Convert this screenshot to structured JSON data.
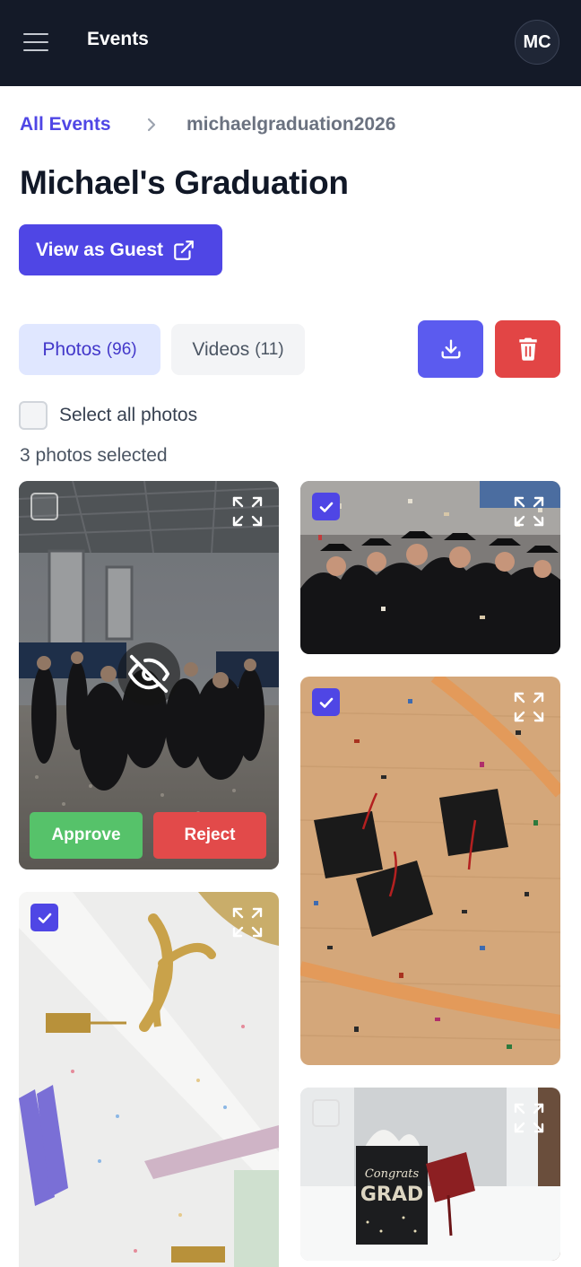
{
  "header": {
    "title": "Events",
    "avatar_initials": "MC"
  },
  "breadcrumb": {
    "parent": "All Events",
    "current": "michaelgraduation2026"
  },
  "page": {
    "title": "Michael's Graduation",
    "view_as_guest": "View as Guest"
  },
  "tabs": [
    {
      "label": "Photos",
      "count": "(96)",
      "active": true
    },
    {
      "label": "Videos",
      "count": "(11)",
      "active": false
    }
  ],
  "actions": {
    "download_icon": "download-icon",
    "delete_icon": "trash-icon"
  },
  "selection": {
    "select_all_label": "Select all photos",
    "selected_count": "3 photos selected"
  },
  "moderation": {
    "approve": "Approve",
    "reject": "Reject"
  },
  "photos": [
    {
      "subject": "graduates dancing in gym",
      "selected": false,
      "hidden": true
    },
    {
      "subject": "graduates celebrating with confetti",
      "selected": true,
      "hidden": false
    },
    {
      "subject": "graduation caps on confetti floor",
      "selected": true,
      "hidden": false
    },
    {
      "subject": "diploma with gold ribbon and tassels",
      "selected": true,
      "hidden": false
    },
    {
      "subject": "congrats grad gift bag",
      "selected": false,
      "hidden": false
    }
  ],
  "gift_bag_text": {
    "line1": "Congrats",
    "line2": "GRAD"
  },
  "colors": {
    "primary": "#4f46e5",
    "danger": "#e24545",
    "approve": "#56c26a",
    "topbar": "#141a28"
  }
}
